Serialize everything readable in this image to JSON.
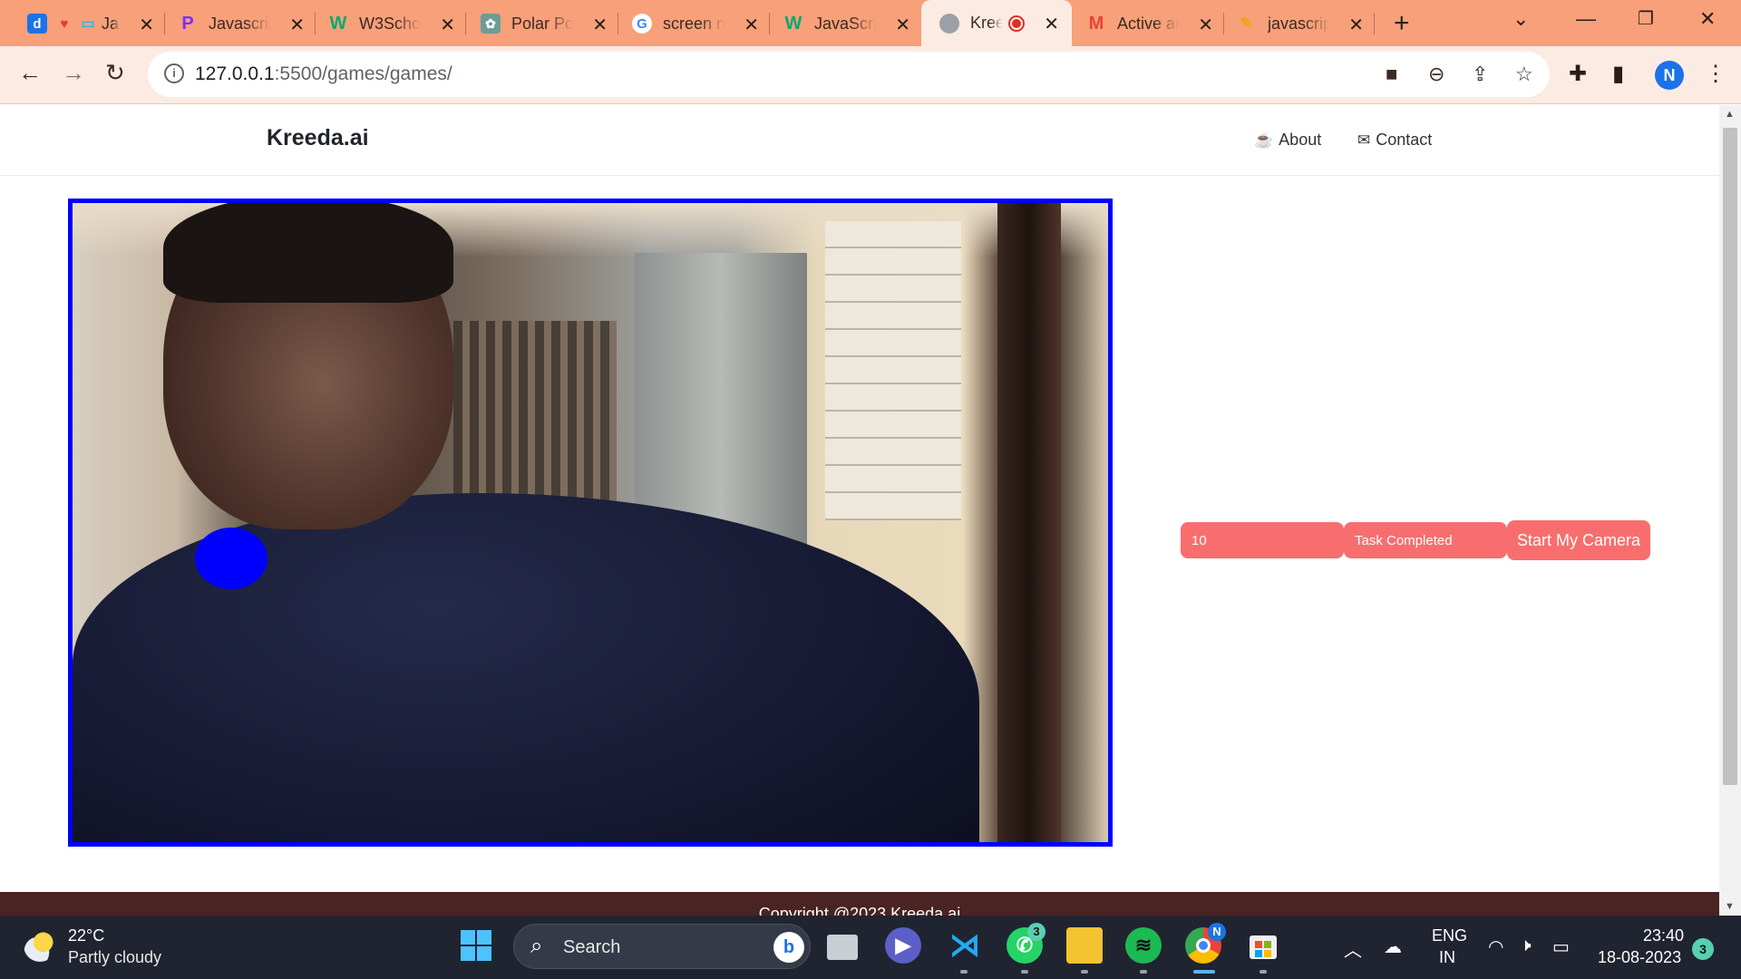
{
  "browser": {
    "tabs": [
      {
        "label": "Ja",
        "favicon": "d",
        "favicon_color": "#1a73e8",
        "active": false
      },
      {
        "label": "Javascrip",
        "favicon": "P",
        "favicon_color": "#7b2ff7",
        "active": false
      },
      {
        "label": "W3Schoo",
        "favicon": "W",
        "favicon_color": "#04aa6d",
        "active": false
      },
      {
        "label": "Polar Poi",
        "favicon": "✿",
        "favicon_color": "#5f8f8a",
        "active": false
      },
      {
        "label": "screen re",
        "favicon": "G",
        "favicon_color": "#4285f4",
        "active": false
      },
      {
        "label": "JavaScrip",
        "favicon": "W",
        "favicon_color": "#04aa6d",
        "active": false
      },
      {
        "label": "Kree",
        "favicon": "●",
        "favicon_color": "#9aa0a6",
        "active": true
      },
      {
        "label": "Active ar",
        "favicon": "M",
        "favicon_color": "#ea4335",
        "active": false
      },
      {
        "label": "javascrip",
        "favicon": "✎",
        "favicon_color": "#f4a21c",
        "active": false
      }
    ],
    "close_glyph": "✕",
    "new_tab": "+",
    "url_host": "127.0.0.1",
    "url_path": ":5500/games/games/",
    "profile_initial": "N"
  },
  "site": {
    "brand": "Kreeda.ai",
    "nav": {
      "about": "About",
      "contact": "Contact"
    },
    "controls": {
      "score": "10",
      "status": "Task Completed",
      "start": "Start My Camera"
    },
    "footer": "Copyright @2023 Kreeda.ai",
    "accent_color": "#f86e6e",
    "camera_border_color": "#0000ff",
    "target_color": "#0000ff"
  },
  "taskbar": {
    "weather_temp": "22°C",
    "weather_cond": "Partly cloudy",
    "search_label": "Search",
    "whatsapp_badge": "3",
    "chrome_badge": "N",
    "lang": "ENG",
    "region": "IN",
    "time": "23:40",
    "date": "18-08-2023",
    "notifications": "3"
  }
}
